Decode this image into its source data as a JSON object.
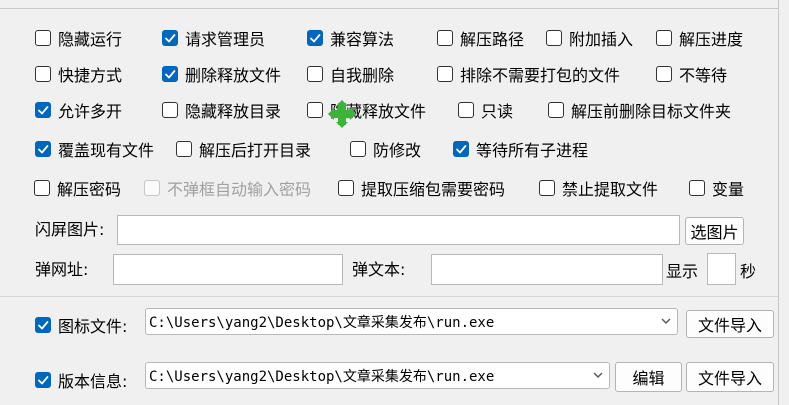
{
  "checkboxes": {
    "hide_run": {
      "label": "隐藏运行",
      "checked": false
    },
    "request_admin": {
      "label": "请求管理员",
      "checked": true
    },
    "compat_algo": {
      "label": "兼容算法",
      "checked": true
    },
    "extract_path": {
      "label": "解压路径",
      "checked": false
    },
    "attach_insert": {
      "label": "附加插入",
      "checked": false
    },
    "extract_progress": {
      "label": "解压进度",
      "checked": false
    },
    "shortcut": {
      "label": "快捷方式",
      "checked": false
    },
    "delete_released": {
      "label": "删除释放文件",
      "checked": true
    },
    "self_delete": {
      "label": "自我删除",
      "checked": false
    },
    "exclude_unneeded": {
      "label": "排除不需要打包的文件",
      "checked": false
    },
    "no_wait": {
      "label": "不等待",
      "checked": false
    },
    "allow_multi": {
      "label": "允许多开",
      "checked": true
    },
    "hide_release_dir": {
      "label": "隐藏释放目录",
      "checked": false
    },
    "hide_release_file": {
      "label": "隐藏释放文件",
      "checked": false
    },
    "read_only": {
      "label": "只读",
      "checked": false
    },
    "delete_target_before": {
      "label": "解压前删除目标文件夹",
      "checked": false
    },
    "overwrite_existing": {
      "label": "覆盖现有文件",
      "checked": true
    },
    "open_dir_after": {
      "label": "解压后打开目录",
      "checked": false
    },
    "prevent_modify": {
      "label": "防修改",
      "checked": false
    },
    "wait_children": {
      "label": "等待所有子进程",
      "checked": true
    },
    "extract_password": {
      "label": "解压密码",
      "checked": false
    },
    "no_popup_password": {
      "label": "不弹框自动输入密码",
      "checked": false,
      "disabled": true
    },
    "extract_needs_password": {
      "label": "提取压缩包需要密码",
      "checked": false
    },
    "forbid_extract": {
      "label": "禁止提取文件",
      "checked": false
    },
    "variable": {
      "label": "变量",
      "checked": false
    },
    "icon_file": {
      "label": "图标文件:",
      "checked": true
    },
    "version_info": {
      "label": "版本信息:",
      "checked": true
    }
  },
  "splash": {
    "label": "闪屏图片:",
    "value": "",
    "button": "选图片"
  },
  "popup": {
    "url_label": "弹网址:",
    "url_value": "",
    "text_label": "弹文本:",
    "text_value": "",
    "show_label": "显示",
    "seconds_value": "",
    "seconds_unit": "秒"
  },
  "icon": {
    "path": "C:\\Users\\yang2\\Desktop\\文章采集发布\\run.exe",
    "import_button": "文件导入"
  },
  "version": {
    "path": "C:\\Users\\yang2\\Desktop\\文章采集发布\\run.exe",
    "edit_button": "编辑",
    "import_button": "文件导入"
  },
  "colors": {
    "accent": "#0067c0",
    "cursor": "#3cb43c"
  }
}
